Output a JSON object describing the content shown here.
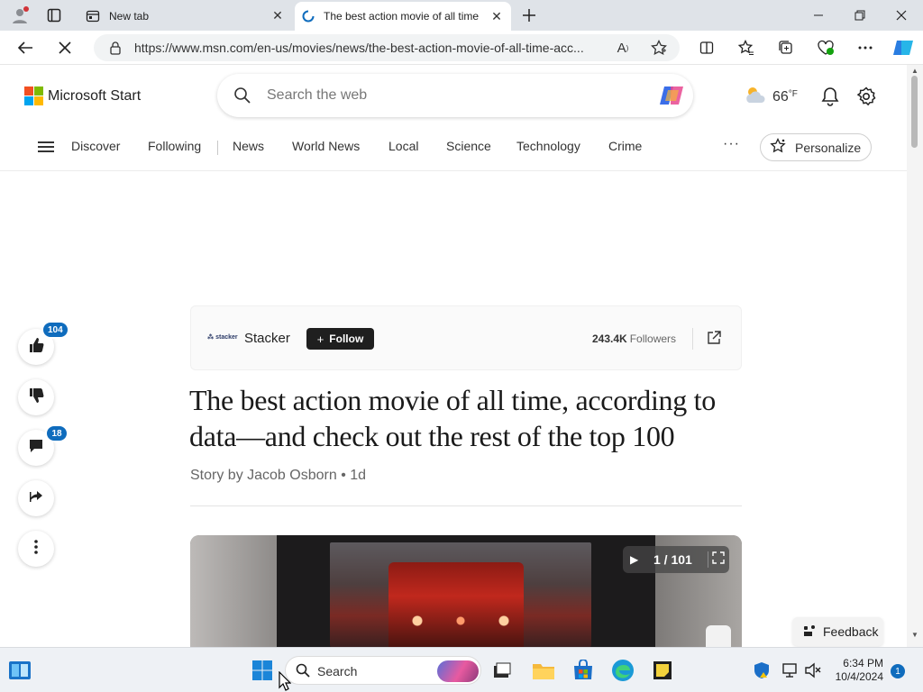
{
  "colors": {
    "accent": "#0f6cbd",
    "ms_red": "#f25022",
    "ms_green": "#7fba00",
    "ms_blue": "#00a4ef",
    "ms_yellow": "#ffb900"
  },
  "browser": {
    "tabs": [
      {
        "title": "New tab",
        "active": false,
        "icon": "new-tab-icon"
      },
      {
        "title": "The best action movie of all time",
        "active": true,
        "icon": "loading-icon"
      }
    ],
    "url": "https://www.msn.com/en-us/movies/news/the-best-action-movie-of-all-time-acc...",
    "icons": [
      "profile-icon",
      "workspaces-icon",
      "back-icon",
      "stop-loading-icon",
      "site-info-icon",
      "read-aloud-icon",
      "favorite-star-icon",
      "split-screen-icon",
      "favorites-icon",
      "collections-icon",
      "browser-essentials-icon",
      "more-icon",
      "copilot-icon"
    ]
  },
  "header": {
    "brand": "Microsoft Start",
    "search_placeholder": "Search the web",
    "weather": {
      "temp": "66",
      "unit": "°F"
    },
    "nav": [
      "Discover",
      "Following",
      "News",
      "World News",
      "Local",
      "Science",
      "Technology",
      "Crime"
    ],
    "more": "···",
    "personalize": "Personalize"
  },
  "rail": {
    "likes": "104",
    "comments": "18"
  },
  "article": {
    "publisher": "Stacker",
    "publisher_logo_text": "stacker",
    "follow": "Follow",
    "followers_count": "243.4K",
    "followers_label": "Followers",
    "headline": "The best action movie of all time, according to data—and check out the rest of the top 100",
    "byline": "Story by Jacob Osborn • 1d",
    "gallery_counter": "1 / 101"
  },
  "feedback": "Feedback",
  "taskbar": {
    "search_label": "Search",
    "time": "6:34 PM",
    "date": "10/4/2024",
    "notifications": "1"
  }
}
